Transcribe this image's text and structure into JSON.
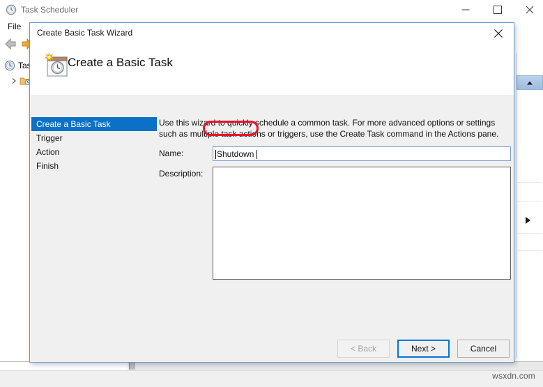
{
  "main_window": {
    "title": "Task Scheduler",
    "title_icon": "clock-icon",
    "menu": {
      "file": "File"
    },
    "toolbar": {
      "back_icon": "back-arrow-icon",
      "forward_icon": "forward-arrow-icon"
    },
    "tree": [
      {
        "label": "Tas",
        "icon": "clock-icon"
      },
      {
        "label": "",
        "icon": "folder-clock-icon"
      }
    ],
    "window_controls": {
      "minimize": "minimize-icon",
      "maximize": "maximize-icon",
      "close": "close-icon"
    },
    "watermark": "wsxdn.com"
  },
  "dialog": {
    "title": "Create Basic Task Wizard",
    "close_icon": "close-icon",
    "header": {
      "icon": "task-calendar-clock-icon",
      "heading": "Create a Basic Task"
    },
    "nav": [
      {
        "label": "Create a Basic Task",
        "selected": true
      },
      {
        "label": "Trigger",
        "selected": false
      },
      {
        "label": "Action",
        "selected": false
      },
      {
        "label": "Finish",
        "selected": false
      }
    ],
    "intro": "Use this wizard to quickly schedule a common task.  For more advanced options or settings such as multiple task actions or triggers, use the Create Task command in the Actions pane.",
    "fields": {
      "name_label": "Name:",
      "name_value": "Shutdown",
      "name_placeholder": "",
      "description_label": "Description:",
      "description_value": "",
      "description_placeholder": ""
    },
    "buttons": {
      "back": "< Back",
      "next": "Next >",
      "cancel": "Cancel"
    },
    "annotation_color": "#e8112d",
    "accent_color": "#0b71c6"
  }
}
